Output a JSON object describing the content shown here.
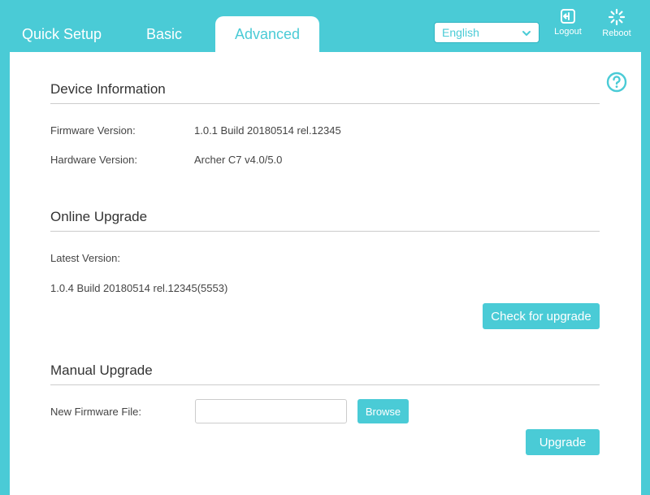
{
  "nav": {
    "tabs": [
      {
        "label": "Quick Setup"
      },
      {
        "label": "Basic"
      },
      {
        "label": "Advanced"
      }
    ],
    "language": "English",
    "logout_label": "Logout",
    "reboot_label": "Reboot"
  },
  "device_info": {
    "title": "Device Information",
    "firmware_label": "Firmware Version:",
    "firmware_value": "1.0.1 Build 20180514 rel.12345",
    "hardware_label": "Hardware Version:",
    "hardware_value": "Archer C7 v4.0/5.0"
  },
  "online_upgrade": {
    "title": "Online Upgrade",
    "latest_label": "Latest Version:",
    "latest_value": "1.0.4 Build 20180514 rel.12345(5553)",
    "check_button": "Check for upgrade"
  },
  "manual_upgrade": {
    "title": "Manual Upgrade",
    "file_label": "New Firmware File:",
    "file_value": "",
    "browse_button": "Browse",
    "upgrade_button": "Upgrade"
  },
  "colors": {
    "accent": "#4acbd6",
    "panel": "#ffffff",
    "text": "#333333"
  }
}
